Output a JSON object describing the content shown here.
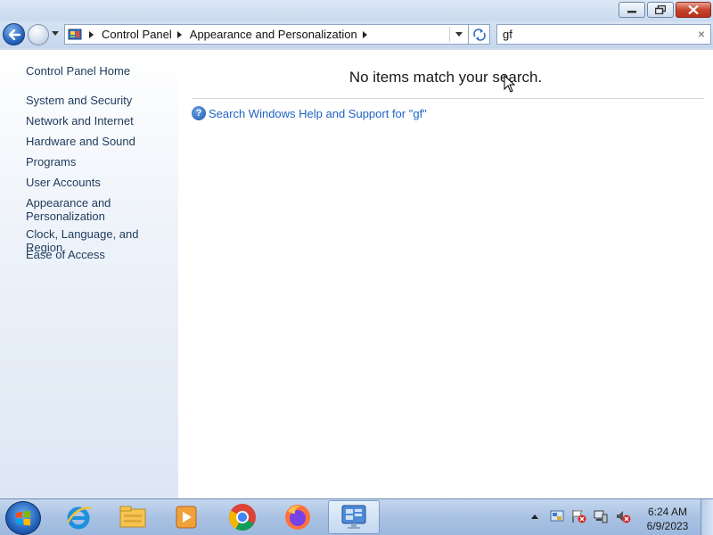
{
  "window": {
    "buttons": [
      "minimize-icon",
      "restore-icon",
      "close-icon"
    ],
    "close_color": "#c7442d"
  },
  "navigation": {
    "breadcrumbs": [
      "Control Panel",
      "Appearance and Personalization"
    ]
  },
  "search": {
    "value": "gf",
    "clear_glyph": "×"
  },
  "sidebar": {
    "home": "Control Panel Home",
    "items": [
      "System and Security",
      "Network and Internet",
      "Hardware and Sound",
      "Programs",
      "User Accounts",
      "Appearance and Personalization",
      "Clock, Language, and Region",
      "Ease of Access"
    ]
  },
  "main": {
    "message": "No items match your search.",
    "help_link": "Search Windows Help and Support for \"gf\""
  },
  "taskbar": {
    "apps": [
      "internet-explorer-icon",
      "file-explorer-icon",
      "media-player-icon",
      "chrome-icon",
      "firefox-icon",
      "control-panel-icon"
    ],
    "active_app": "control-panel-icon",
    "tray_icons": [
      "language-bar-icon",
      "action-center-icon",
      "network-icon",
      "volume-muted-icon"
    ],
    "time": "6:24 AM",
    "date": "6/9/2023"
  },
  "colors": {
    "link": "#1e63c4",
    "accent": "#1d5bb8"
  }
}
